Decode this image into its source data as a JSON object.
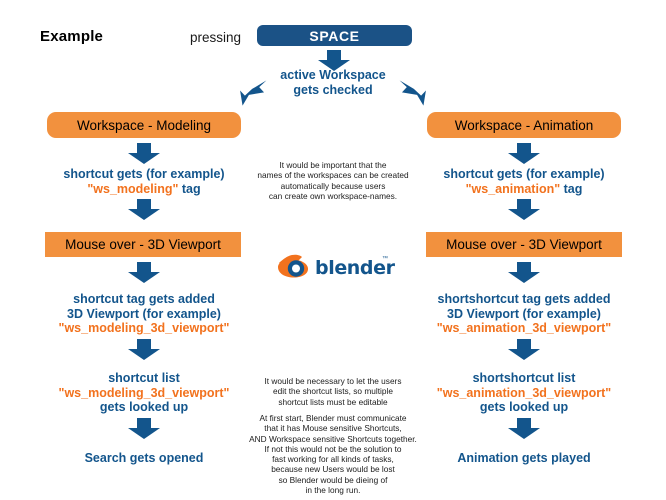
{
  "page": {
    "title": "Example",
    "accent_blue": "#13558C",
    "key_blue": "#1b5286",
    "orange_box": "#F2913E",
    "tag_orange": "#F2721E"
  },
  "top": {
    "pressing_label": "pressing",
    "space_key_label": "SPACE",
    "active_workspace_line1": "active Workspace",
    "active_workspace_line2": "gets checked"
  },
  "left_branch": {
    "workspace_box": "Workspace - Modeling",
    "shortcut_gets_line1": "shortcut gets (for example)",
    "shortcut_gets_tag": "\"ws_modeling\"",
    "shortcut_gets_suffix": " tag",
    "mouse_over_box": "Mouse over - 3D Viewport",
    "tag_added_line1": "shortcut tag gets added",
    "tag_added_line2": "3D Viewport (for example)",
    "tag_added_tag": "\"ws_modeling_3d_viewport\"",
    "list_line1": "shortcut list",
    "list_tag": "\"ws_modeling_3d_viewport\"",
    "list_line3": "gets looked up",
    "result": "Search gets opened"
  },
  "right_branch": {
    "workspace_box": "Workspace - Animation",
    "shortcut_gets_line1": "shortcut gets (for example)",
    "shortcut_gets_tag": "\"ws_animation\"",
    "shortcut_gets_suffix": " tag",
    "mouse_over_box": "Mouse over - 3D Viewport",
    "tag_added_line1": "shortshortcut tag gets added",
    "tag_added_line2": "3D Viewport (for example)",
    "tag_added_tag": "\"ws_animation_3d_viewport\"",
    "list_line1": "shortshortcut list",
    "list_tag": "\"ws_animation_3d_viewport\"",
    "list_line3": "gets looked up",
    "result": "Animation gets played"
  },
  "notes": {
    "note_top": "It would be important that the\nnames of the workspaces can be created\nautomatically because users\ncan create own workspace-names.",
    "note_mid": "It would be necessary to let the users\nedit the shortcut lists, so multiple\nshortcut lists must be editable",
    "note_bottom": "At first start, Blender must communicate\nthat it has  Mouse sensitive Shortcuts,\nAND Workspace sensitive Shortcuts together.\nIf not this would not be the solution to\nfast working for all kinds of tasks,\nbecause new Users would be lost\nso Blender would be dieing of\nin the long run."
  },
  "logo": {
    "wordmark": "blender",
    "trademark": "™"
  }
}
